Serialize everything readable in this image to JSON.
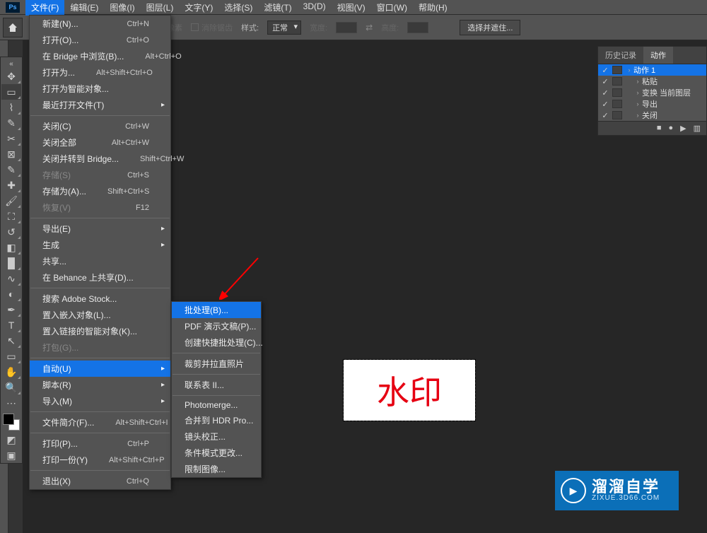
{
  "menubar": [
    "文件(F)",
    "编辑(E)",
    "图像(I)",
    "图层(L)",
    "文字(Y)",
    "选择(S)",
    "滤镜(T)",
    "3D(D)",
    "视图(V)",
    "窗口(W)",
    "帮助(H)"
  ],
  "optionsbar": {
    "pixels": "像素",
    "antialias": "消除锯齿",
    "style_label": "样式:",
    "style_value": "正常",
    "width_label": "宽度:",
    "height_label": "高度:",
    "select_mask": "选择并遮住..."
  },
  "file_menu": [
    {
      "label": "新建(N)...",
      "shortcut": "Ctrl+N"
    },
    {
      "label": "打开(O)...",
      "shortcut": "Ctrl+O"
    },
    {
      "label": "在 Bridge 中浏览(B)...",
      "shortcut": "Alt+Ctrl+O"
    },
    {
      "label": "打开为...",
      "shortcut": "Alt+Shift+Ctrl+O"
    },
    {
      "label": "打开为智能对象..."
    },
    {
      "label": "最近打开文件(T)",
      "sub": true
    },
    {
      "sep": true
    },
    {
      "label": "关闭(C)",
      "shortcut": "Ctrl+W"
    },
    {
      "label": "关闭全部",
      "shortcut": "Alt+Ctrl+W"
    },
    {
      "label": "关闭并转到 Bridge...",
      "shortcut": "Shift+Ctrl+W"
    },
    {
      "label": "存储(S)",
      "shortcut": "Ctrl+S",
      "disabled": true
    },
    {
      "label": "存储为(A)...",
      "shortcut": "Shift+Ctrl+S"
    },
    {
      "label": "恢复(V)",
      "shortcut": "F12",
      "disabled": true
    },
    {
      "sep": true
    },
    {
      "label": "导出(E)",
      "sub": true
    },
    {
      "label": "生成",
      "sub": true
    },
    {
      "label": "共享..."
    },
    {
      "label": "在 Behance 上共享(D)..."
    },
    {
      "sep": true
    },
    {
      "label": "搜索 Adobe Stock..."
    },
    {
      "label": "置入嵌入对象(L)..."
    },
    {
      "label": "置入链接的智能对象(K)..."
    },
    {
      "label": "打包(G)...",
      "disabled": true
    },
    {
      "sep": true
    },
    {
      "label": "自动(U)",
      "sub": true,
      "highlight": true
    },
    {
      "label": "脚本(R)",
      "sub": true
    },
    {
      "label": "导入(M)",
      "sub": true
    },
    {
      "sep": true
    },
    {
      "label": "文件简介(F)...",
      "shortcut": "Alt+Shift+Ctrl+I"
    },
    {
      "sep": true
    },
    {
      "label": "打印(P)...",
      "shortcut": "Ctrl+P"
    },
    {
      "label": "打印一份(Y)",
      "shortcut": "Alt+Shift+Ctrl+P"
    },
    {
      "sep": true
    },
    {
      "label": "退出(X)",
      "shortcut": "Ctrl+Q"
    }
  ],
  "auto_menu": [
    {
      "label": "批处理(B)...",
      "highlight": true
    },
    {
      "label": "PDF 演示文稿(P)..."
    },
    {
      "label": "创建快捷批处理(C)..."
    },
    {
      "sep": true
    },
    {
      "label": "裁剪并拉直照片"
    },
    {
      "sep": true
    },
    {
      "label": "联系表 II..."
    },
    {
      "sep": true
    },
    {
      "label": "Photomerge..."
    },
    {
      "label": "合并到 HDR Pro..."
    },
    {
      "label": "镜头校正..."
    },
    {
      "label": "条件模式更改..."
    },
    {
      "label": "限制图像..."
    }
  ],
  "rightpanel": {
    "tab_history": "历史记录",
    "tab_actions": "动作",
    "rows": [
      {
        "label": "动作 1",
        "indent": 0,
        "sel": true
      },
      {
        "label": "粘贴",
        "indent": 1
      },
      {
        "label": "变换 当前图层",
        "indent": 1
      },
      {
        "label": "导出",
        "indent": 1
      },
      {
        "label": "关闭",
        "indent": 1
      }
    ]
  },
  "canvas": {
    "watermark_text": "水印"
  },
  "logo": {
    "cn": "溜溜自学",
    "en": "ZIXUE.3D66.COM"
  },
  "tools": [
    "move",
    "marquee",
    "lasso",
    "quick-select",
    "crop",
    "frame",
    "eyedropper",
    "heal",
    "brush",
    "stamp",
    "history-brush",
    "eraser",
    "gradient",
    "blur",
    "dodge",
    "pen",
    "type",
    "path-select",
    "rectangle",
    "hand",
    "zoom",
    "more"
  ],
  "tool_icons": {
    "move": "✥",
    "marquee": "▭",
    "lasso": "⌇",
    "quick-select": "✎",
    "crop": "✂",
    "frame": "⊠",
    "eyedropper": "✎",
    "heal": "✚",
    "brush": "🖌",
    "stamp": "⛶",
    "history-brush": "↺",
    "eraser": "◧",
    "gradient": "█",
    "blur": "∿",
    "dodge": "◐",
    "pen": "✒",
    "type": "T",
    "path-select": "↖",
    "rectangle": "▭",
    "hand": "✋",
    "zoom": "🔍",
    "more": "⋯"
  }
}
